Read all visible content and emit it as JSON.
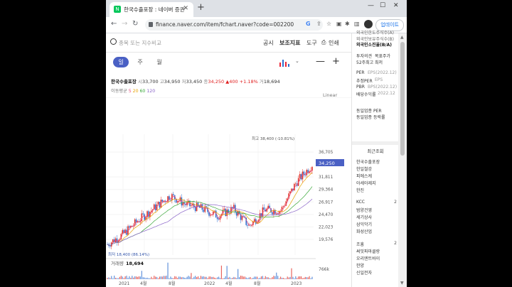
{
  "browser": {
    "tab_title": "한국수출포장 : 네이버 증권",
    "favicon_letter": "N",
    "url": "finance.naver.com/item/fchart.naver?code=002200",
    "update_label": "업데이트"
  },
  "toolbar": {
    "search_placeholder": "종목 또는 지수비교",
    "menu_notice": "공시",
    "menu_indicator": "보조지표",
    "menu_tools": "도구",
    "menu_print": "인쇄"
  },
  "periods": [
    {
      "label": "일",
      "active": true
    },
    {
      "label": "주",
      "active": false
    },
    {
      "label": "월",
      "active": false
    }
  ],
  "stock": {
    "name": "한국수출포장",
    "open_label": "시",
    "open": "33,700",
    "high_label": "고",
    "high": "34,950",
    "low_label": "저",
    "low": "33,450",
    "close_label": "종",
    "close": "34,250",
    "change": "▲400",
    "change_pct": "+1.18%",
    "volume_label": "거",
    "volume": "18,694"
  },
  "ma_legend": {
    "label": "이동평균",
    "m5": "5",
    "m20": "20",
    "m60": "60",
    "m120": "120"
  },
  "scale_label": "Linear",
  "chart_data": {
    "type": "candlestick",
    "x": [
      "2020-12",
      "2021-02",
      "2021-04",
      "2021-06",
      "2021-08",
      "2021-10",
      "2021-12",
      "2022-02",
      "2022-04",
      "2022-06",
      "2022-08",
      "2022-10",
      "2022-12",
      "2023-02"
    ],
    "close": [
      18600,
      20600,
      23400,
      25800,
      28200,
      26400,
      25600,
      24200,
      25600,
      22200,
      25400,
      25200,
      30800,
      34250
    ],
    "ylim": [
      16500,
      40200
    ],
    "y_ticks": [
      "36,705",
      "34,250",
      "31,811",
      "29,364",
      "26,917",
      "24,470",
      "22,023",
      "19,576"
    ],
    "x_tick_labels": [
      "2021",
      "4월",
      "8월",
      "2022",
      "4월",
      "8월",
      "2023"
    ],
    "current_price_label": "34,250",
    "max_label": "최고 38,400 (-10.81%)",
    "min_label": "최저 18,400 (86.14%)",
    "volume_title": "거래량",
    "volume_value": "18,694",
    "volume_tick": "766k",
    "colors": {
      "up": "#e0312a",
      "down": "#2f6fd0",
      "ma5": "#e7487a",
      "ma20": "#e8a200",
      "ma60": "#3aa83a",
      "ma120": "#8a64c8"
    }
  },
  "sidebar": {
    "lines_top": [
      "외국인한도주식수(A)",
      "외국인보유주식수(B)",
      "외국인소진율(B/A)"
    ],
    "invest_opinion": "투자의견",
    "target_price": "목표주가",
    "high52": "52주최고",
    "low52": "최저",
    "per": "PER",
    "per_sub": "EPS(2022.12)",
    "est_per": "추정PER",
    "est_sub": "EPS",
    "pbr": "PBR",
    "pbr_sub": "BPS(2022.12)",
    "dividend": "배당수익률",
    "dividend_sub": "2022.12",
    "same_per": "동일업종 PER",
    "same_rate": "동일업종 등락률",
    "recent_title": "최근조회",
    "recent": [
      "한국수출포장",
      "한일철강",
      "피에스케",
      "아세아제지",
      "한진"
    ],
    "group2": [
      "KCC",
      "범양건영",
      "세기상사",
      "삼익악기",
      "화성산업"
    ],
    "group2_num": "2",
    "group3": [
      "조흥",
      "써밋파마클랑",
      "오리엔트바이",
      "한양",
      "신일전자"
    ],
    "group3_num": "2"
  }
}
